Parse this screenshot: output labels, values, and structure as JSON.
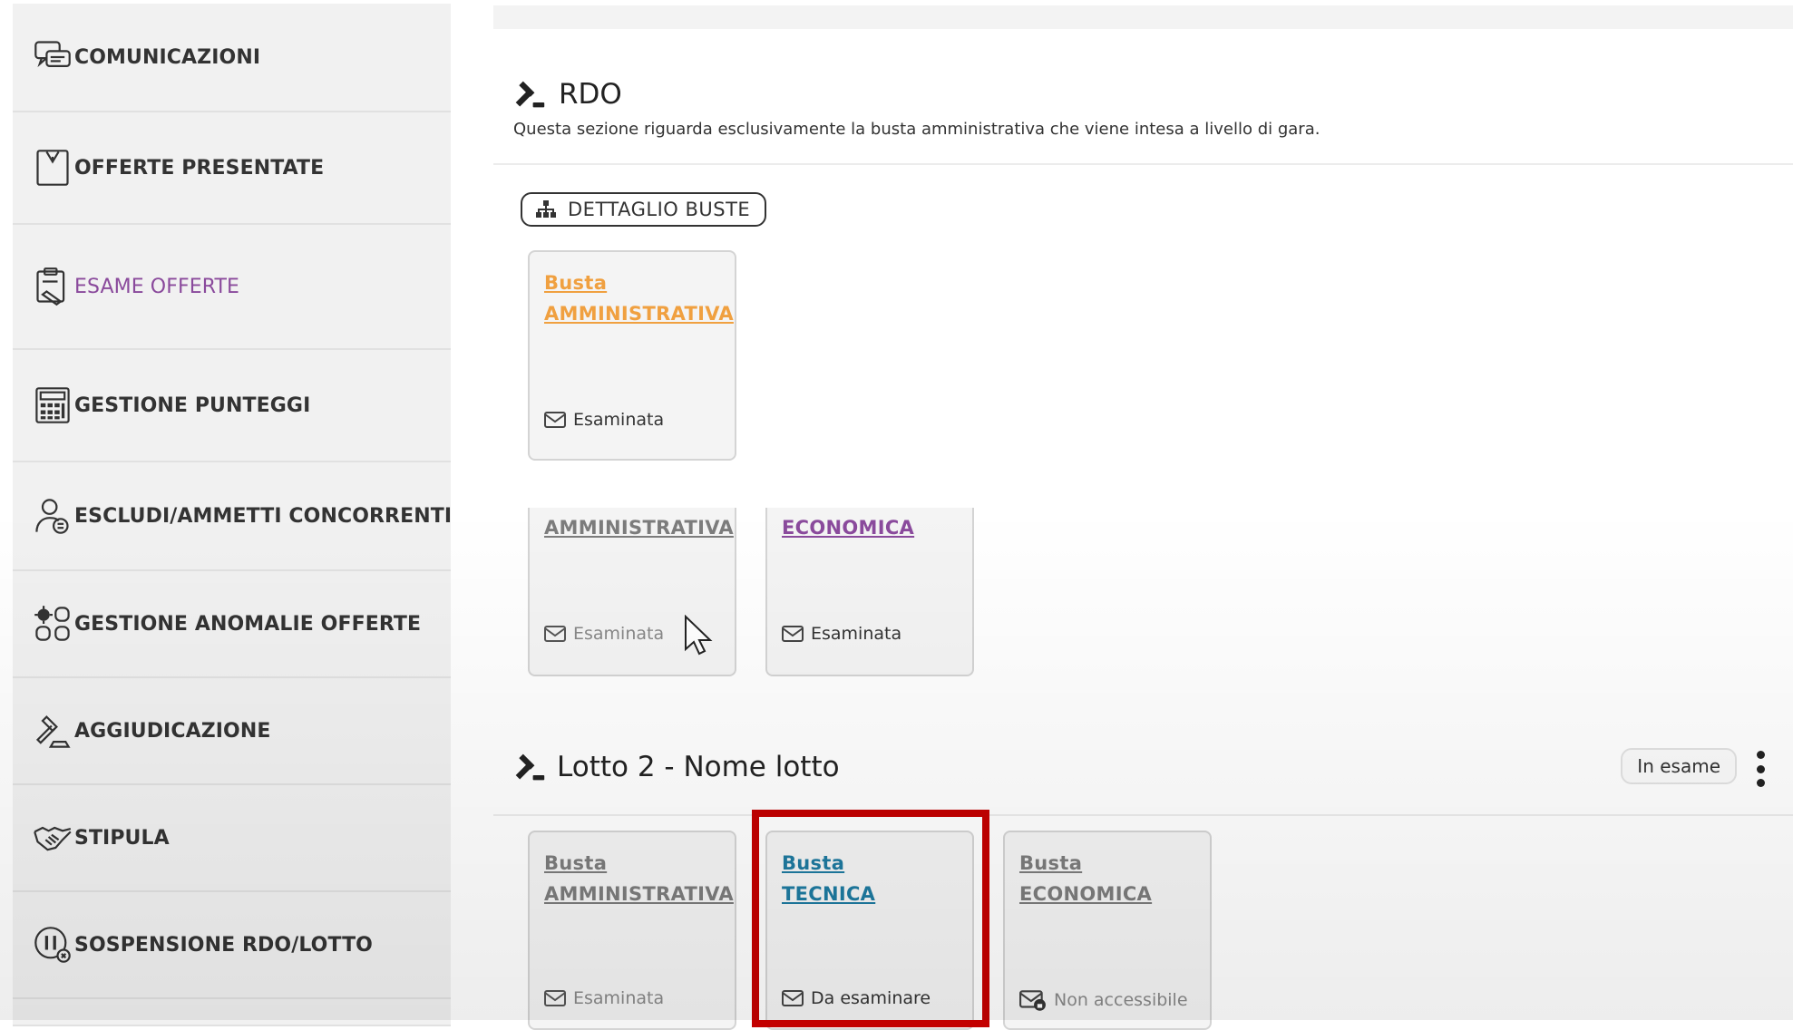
{
  "sidebar": {
    "items": [
      {
        "label": "COMUNICAZIONI"
      },
      {
        "label": "OFFERTE PRESENTATE"
      },
      {
        "label": "ESAME OFFERTE"
      },
      {
        "label": "GESTIONE PUNTEGGI"
      },
      {
        "label": "ESCLUDI/AMMETTI CONCORRENTI"
      },
      {
        "label": "GESTIONE ANOMALIE OFFERTE"
      },
      {
        "label": "AGGIUDICAZIONE"
      },
      {
        "label": "STIPULA"
      },
      {
        "label": "SOSPENSIONE RDO/LOTTO"
      }
    ]
  },
  "rdo": {
    "title": "RDO",
    "description": "Questa sezione riguarda esclusivamente la busta amministrativa che viene intesa a livello di gara.",
    "dettaglio_button": "DETTAGLIO BUSTE",
    "card_busta_amministrativa": {
      "line1": "Busta",
      "line2": "AMMINISTRATIVA",
      "status": "Esaminata"
    }
  },
  "lotto1_partial": {
    "card_amministrativa": {
      "line2": "AMMINISTRATIVA",
      "status": "Esaminata"
    },
    "card_economica": {
      "line2": "ECONOMICA",
      "status": "Esaminata"
    }
  },
  "lotto2": {
    "title": "Lotto 2 - Nome lotto",
    "state_badge": "In esame",
    "cards": [
      {
        "line1": "Busta",
        "line2": "AMMINISTRATIVA",
        "status": "Esaminata"
      },
      {
        "line1": "Busta",
        "line2": "TECNICA",
        "status": "Da esaminare"
      },
      {
        "line1": "Busta",
        "line2": "ECONOMICA",
        "status": "Non accessibile"
      }
    ]
  },
  "colors": {
    "amministrativa_link": "#f0a040",
    "tecnica_link": "#1e7aa0",
    "economica_link": "#8a4a9c",
    "muted_link": "#7c7c7c",
    "active_sidebar": "#8a4a9c",
    "highlight": "#c30000"
  }
}
